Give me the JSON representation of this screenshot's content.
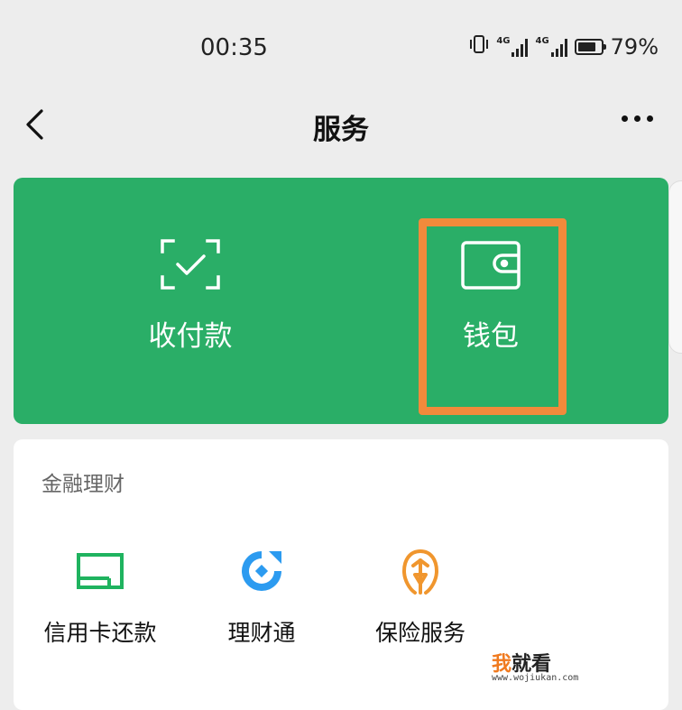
{
  "status_bar": {
    "time": "00:35",
    "network_1": "4G",
    "network_2": "4G",
    "battery_percent": "79%",
    "battery_level": 0.79
  },
  "nav": {
    "title": "服务"
  },
  "wallet_card": {
    "background": "#2aae67",
    "items": [
      {
        "label": "收付款",
        "icon": "scan-check-icon"
      },
      {
        "label": "钱包",
        "icon": "wallet-icon"
      }
    ],
    "highlight_color": "#f28a3b"
  },
  "finance": {
    "title": "金融理财",
    "items": [
      {
        "label": "信用卡还款",
        "icon": "credit-card-icon"
      },
      {
        "label": "理财通",
        "icon": "wealth-icon"
      },
      {
        "label": "保险服务",
        "icon": "insurance-icon"
      }
    ]
  },
  "watermark": {
    "part1": "我",
    "part2": "就看",
    "url": "www.wojiukan.com"
  }
}
